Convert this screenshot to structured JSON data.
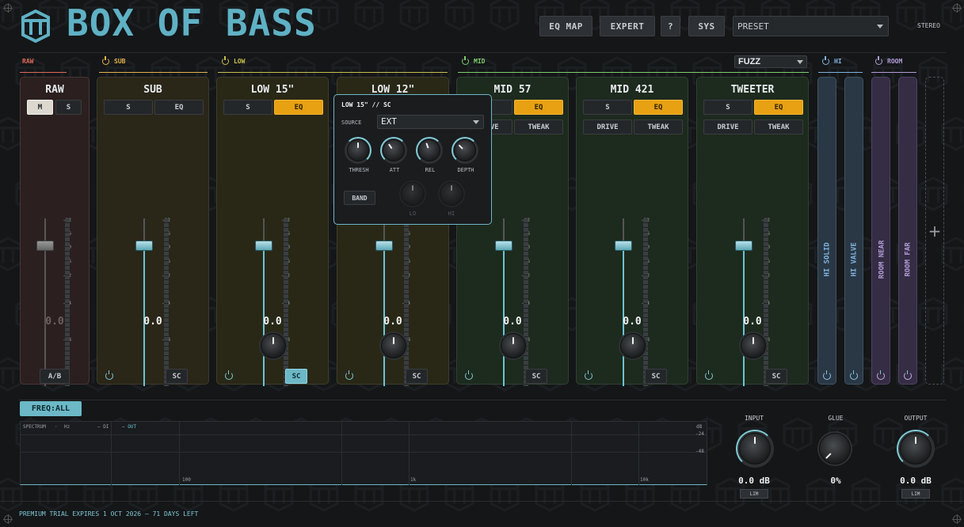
{
  "app": {
    "title": "BOX OF BASS",
    "stereo_label": "STEREO"
  },
  "toolbar": {
    "eq_map": "EQ MAP",
    "expert": "EXPERT",
    "help": "?",
    "sys": "SYS",
    "preset_value": "PRESET"
  },
  "sections": {
    "raw": "RAW",
    "sub": "SUB",
    "low": "LOW",
    "mid": "MID",
    "hi": "HI",
    "room": "ROOM",
    "mid_mode": "FUZZ"
  },
  "strips": {
    "raw": {
      "name": "RAW",
      "m": "M",
      "s": "S",
      "value": "0.0",
      "ab": "A/B"
    },
    "sub": {
      "name": "SUB",
      "s": "S",
      "eq": "EQ",
      "value": "0.0",
      "sc": "SC"
    },
    "low15": {
      "name": "LOW 15\"",
      "s": "S",
      "eq": "EQ",
      "value": "0.0",
      "sc": "SC"
    },
    "low12": {
      "name": "LOW 12\"",
      "value": "0.0",
      "sc": "SC"
    },
    "mid57": {
      "name": "MID 57",
      "s": "S",
      "eq": "EQ",
      "drive": "DRIVE",
      "tweak": "TWEAK",
      "value": "0.0",
      "sc": "SC"
    },
    "mid421": {
      "name": "MID 421",
      "s": "S",
      "eq": "EQ",
      "drive": "DRIVE",
      "tweak": "TWEAK",
      "value": "0.0",
      "sc": "SC"
    },
    "tweeter": {
      "name": "TWEETER",
      "s": "S",
      "eq": "EQ",
      "drive": "DRIVE",
      "tweak": "TWEAK",
      "value": "0.0",
      "sc": "SC"
    }
  },
  "fader_scale": [
    "12",
    "6",
    "0",
    "6",
    "12",
    "24",
    "48"
  ],
  "vertical_strips": {
    "hi_solid": "HI SOLID",
    "hi_valve": "HI VALVE",
    "room_near": "ROOM NEAR",
    "room_far": "ROOM FAR",
    "add": "+"
  },
  "popup": {
    "title": "LOW 15\" // SC",
    "source_label": "SOURCE",
    "source_value": "EXT",
    "knobs": [
      "THRESH",
      "ATT",
      "REL",
      "DEPTH"
    ],
    "band": "BAND",
    "lo": "LO",
    "hi": "HI"
  },
  "bottom": {
    "freq_all": "FREQ:ALL",
    "spectrum_label": "SPECTRUM",
    "hz_label": "Hz",
    "legend_di": "— DI",
    "legend_out": "— OUT",
    "db_label": "dB",
    "db_24": "-24",
    "db_48": "-48",
    "f100": "100",
    "f1k": "1k",
    "f10k": "10k",
    "input_label": "INPUT",
    "glue_label": "GLUE",
    "output_label": "OUTPUT",
    "input_value": "0.0 dB",
    "glue_value": "0%",
    "output_value": "0.0 dB",
    "lim": "LIM"
  },
  "trial_text": "PREMIUM TRIAL EXPIRES 1 OCT 2026 — 71 DAYS LEFT",
  "colors": {
    "accent": "#6cc3d1",
    "eq_on": "#e8a112",
    "raw": "#e06a5a",
    "sub": "#e0b24a",
    "low": "#c8c04a",
    "mid": "#7fcf6a",
    "hi": "#7fb4e0",
    "room": "#b39bd8"
  }
}
